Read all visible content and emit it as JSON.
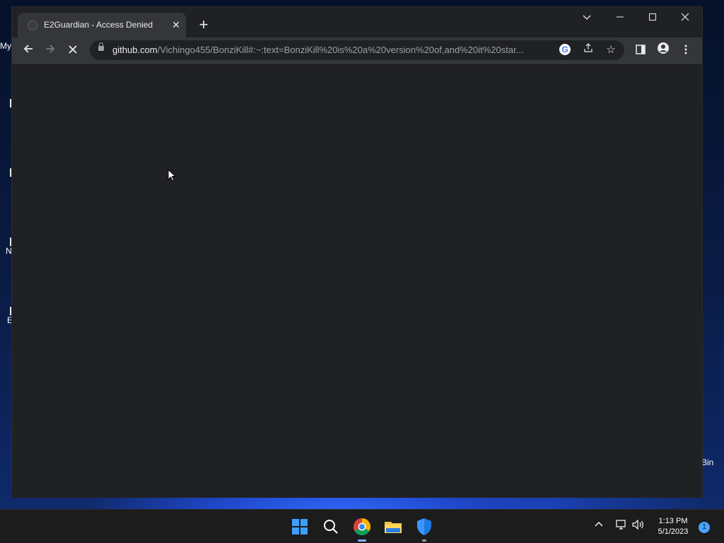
{
  "desktop": {
    "icons": [
      {
        "label": "My"
      },
      {
        "label": ""
      },
      {
        "label": ""
      },
      {
        "label": "N"
      },
      {
        "label": "E"
      }
    ],
    "recycle_bin_label": "Bin"
  },
  "browser": {
    "tab": {
      "title": "E2Guardian - Access Denied"
    },
    "omnibox": {
      "host": "github.com",
      "path": "/Vichingo455/BonziKill#:~:text=BonziKill%20is%20a%20version%20of,and%20it%20star..."
    },
    "page_status": "loading"
  },
  "taskbar": {
    "apps": [
      "start",
      "search",
      "chrome",
      "file-explorer",
      "defender"
    ],
    "clock_time": "1:13 PM",
    "clock_date": "5/1/2023",
    "notification_count": "1"
  }
}
